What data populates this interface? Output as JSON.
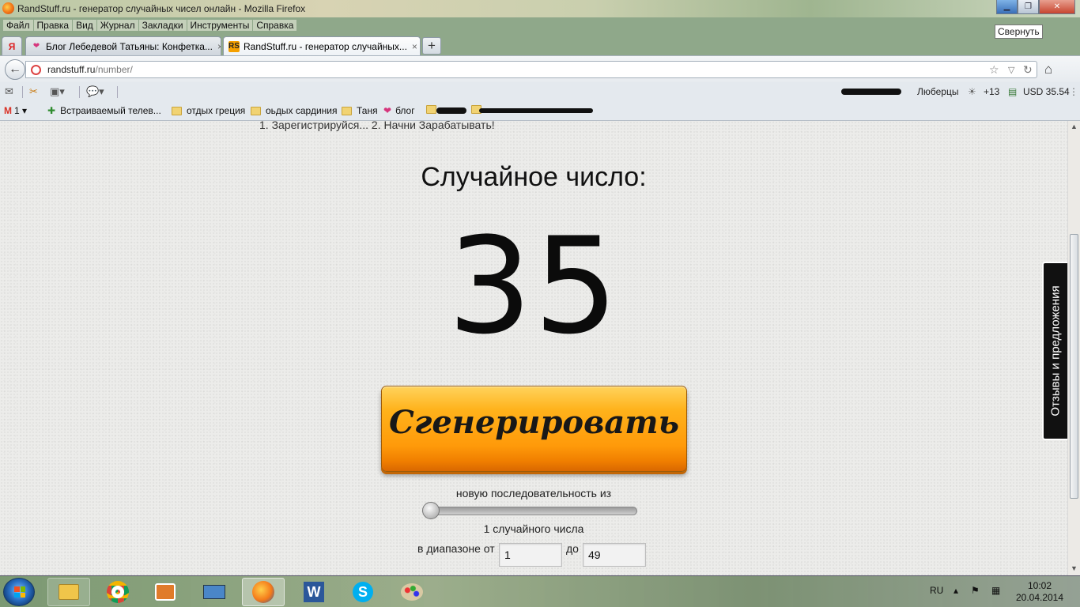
{
  "window": {
    "title": "RandStuff.ru - генератор случайных чисел онлайн - Mozilla Firefox",
    "tooltip": "Свернуть",
    "minimize_glyph": "▁",
    "maximize_glyph": "❐",
    "close_glyph": "✕"
  },
  "menu": [
    "Файл",
    "Правка",
    "Вид",
    "Журнал",
    "Закладки",
    "Инструменты",
    "Справка"
  ],
  "tabs": [
    {
      "label": "Блог Лебедевой Татьяны: Конфетка...",
      "close": "×",
      "icon": "heart-icon"
    },
    {
      "label": "RandStuff.ru - генератор случайных...",
      "close": "×",
      "icon": "randstuff-icon",
      "icon_text": "RS"
    }
  ],
  "tab_prefix": "Я",
  "newtab": "+",
  "nav": {
    "back": "←",
    "url_host": "randstuff.ru",
    "url_path": "/number/",
    "star": "☆",
    "dropdown": "▽",
    "reload": "↻",
    "home": "⌂"
  },
  "toolbar": {
    "city": "Люберцы",
    "weather": "+13",
    "currency": "USD 35.54"
  },
  "bookmarks": {
    "gmail_count": "1",
    "items": [
      "Встраиваемый телев...",
      "отдых греция",
      "оьдых сардиния",
      "Таня",
      "блог"
    ]
  },
  "page": {
    "ad_text": "1. Зарегистрируйся... 2. Начни Зарабатывать!",
    "heading": "Случайное число:",
    "number": "35",
    "button": "Сгенерировать",
    "sequence_label": "новую последовательность из",
    "count_label": "1 случайного числа",
    "range_from_label": "в диапазоне от",
    "range_to_label": "до",
    "range_from": "1",
    "range_to": "49",
    "slider_value": 1,
    "feedback": "Отзывы и предложения"
  },
  "taskbar": {
    "lang": "RU",
    "time": "10:02",
    "date": "20.04.2014"
  }
}
